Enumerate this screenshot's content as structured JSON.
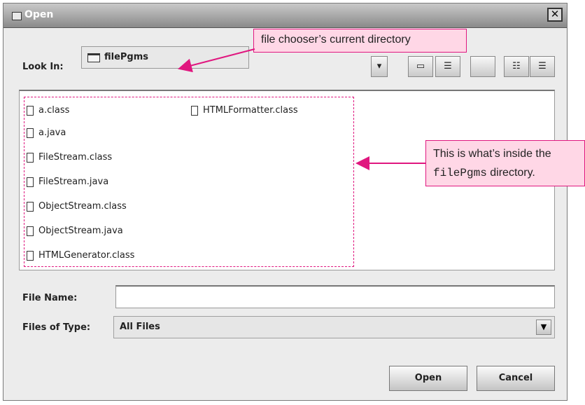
{
  "window": {
    "title": "Open",
    "close_glyph": "✕"
  },
  "lookin": {
    "label": "Look In:",
    "value": "filePgms"
  },
  "toolbar": [
    {
      "name": "up-folder-button",
      "glyph": "▾",
      "icon": "up-folder-icon"
    },
    {
      "name": "home-button",
      "glyph": "⌂",
      "icon": "home-icon"
    },
    {
      "name": "new-folder-button",
      "glyph": "▭",
      "icon": "new-folder-icon"
    },
    {
      "name": "blank-button",
      "glyph": "",
      "icon": "blank-icon"
    },
    {
      "name": "list-view-button",
      "glyph": "☷",
      "icon": "list-view-icon"
    },
    {
      "name": "details-view-button",
      "glyph": "☰",
      "icon": "details-view-icon"
    }
  ],
  "files": [
    "a.class",
    "a.java",
    "FileStream.class",
    "FileStream.java",
    "ObjectStream.class",
    "ObjectStream.java",
    "HTMLFormatter.class",
    "HTMLGenerator.class"
  ],
  "file_name": {
    "label": "File Name:",
    "value": ""
  },
  "file_type": {
    "label": "Files of Type:",
    "value": "All Files"
  },
  "buttons": {
    "open": "Open",
    "cancel": "Cancel"
  },
  "annotations": {
    "current_dir": "file chooser’s current directory",
    "inside_line1": "This is what’s inside the",
    "inside_code": "filePgms",
    "inside_line2_suffix": " directory."
  },
  "colors": {
    "annotation_border": "#e0177f",
    "annotation_fill": "#ffd7e6"
  }
}
